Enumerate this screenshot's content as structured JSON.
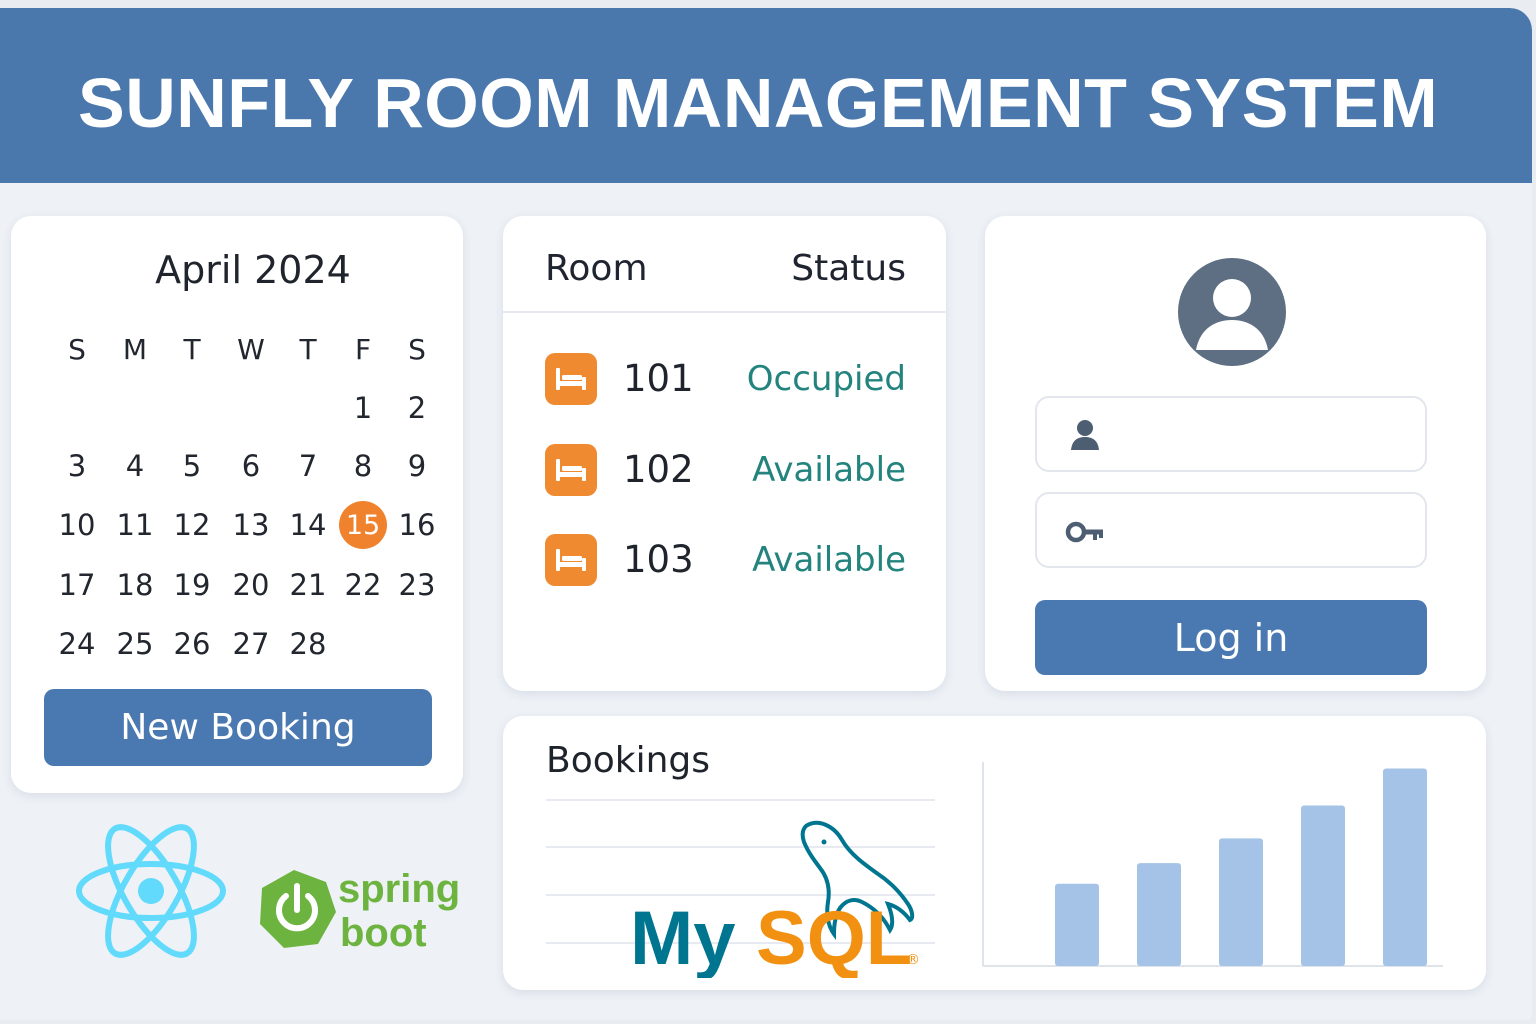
{
  "app": {
    "title": "SUNFLY ROOM MANAGEMENT SYSTEM"
  },
  "calendar": {
    "month_label": "April 2024",
    "weekdays": [
      "S",
      "M",
      "T",
      "W",
      "T",
      "F",
      "S"
    ],
    "first_weekday_index": 5,
    "days_in_month": 28,
    "selected_day": 15,
    "new_booking_label": "New Booking"
  },
  "rooms": {
    "header_room": "Room",
    "header_status": "Status",
    "items": [
      {
        "number": "101",
        "status": "Occupied",
        "icon": "bed-icon"
      },
      {
        "number": "102",
        "status": "Available",
        "icon": "bed-icon"
      },
      {
        "number": "103",
        "status": "Available",
        "icon": "bed-icon"
      }
    ]
  },
  "login": {
    "username_value": "",
    "password_value": "",
    "username_icon": "user-icon",
    "password_icon": "key-icon",
    "button_label": "Log in"
  },
  "bookings": {
    "title": "Bookings"
  },
  "chart_data": {
    "type": "bar",
    "values": [
      2.0,
      2.5,
      3.1,
      3.9,
      4.8
    ],
    "title": "",
    "xlabel": "",
    "ylabel": "",
    "ylim": [
      0,
      5.2
    ],
    "grid": false
  },
  "logos": {
    "react": "react-logo",
    "spring": {
      "line1": "spring",
      "line2": "boot"
    },
    "mysql": {
      "text_my": "My",
      "text_sql": "SQL",
      "mark": "®"
    }
  },
  "colors": {
    "header": "#4a78ad",
    "primary_button": "#4a78b0",
    "accent_orange": "#f0822d",
    "status_teal": "#23837d",
    "bar": "#a4c3e6",
    "spring_green": "#6db33f",
    "react_blue": "#61dafb",
    "mysql_blue": "#00758f",
    "mysql_orange": "#f29111"
  }
}
